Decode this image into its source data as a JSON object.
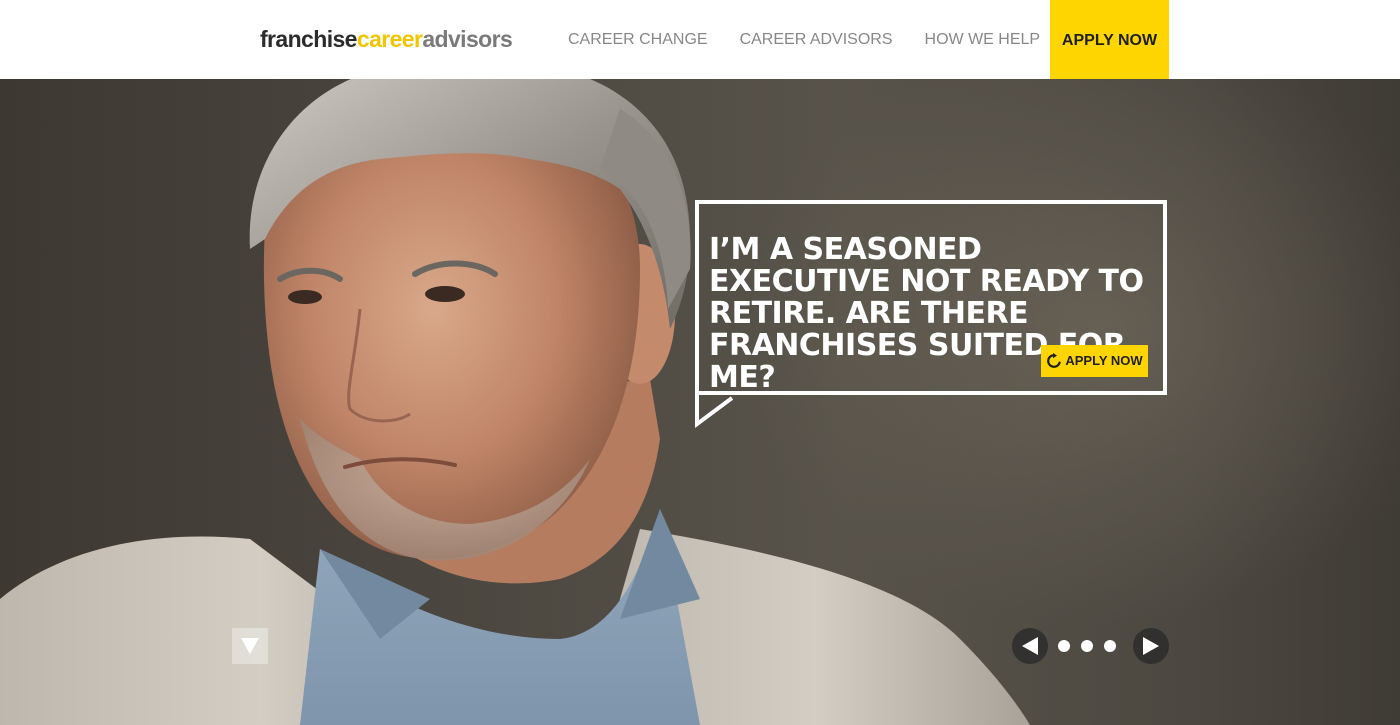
{
  "header": {
    "logo": {
      "part1": "franchise",
      "part2": "career",
      "part3": "advisors"
    },
    "nav": [
      {
        "label": "CAREER CHANGE"
      },
      {
        "label": "CAREER ADVISORS"
      },
      {
        "label": "HOW WE HELP"
      }
    ],
    "apply_label": "APPLY NOW"
  },
  "hero": {
    "headline": "I’M A SEASONED EXECUTIVE NOT READY TO RETIRE. ARE THERE FRANCHISES SUITED FOR ME?",
    "button_label": "APPLY NOW",
    "button_icon": "refresh-icon"
  },
  "slider": {
    "slide_count": 3,
    "prev_icon": "triangle-left-icon",
    "next_icon": "triangle-right-icon",
    "scroll_icon": "triangle-down-icon"
  },
  "colors": {
    "accent": "#ffd500",
    "logo_dark": "#2b2b2b",
    "logo_accent": "#f2c500",
    "logo_gray": "#7a7a7a",
    "nav_text": "#888888"
  }
}
